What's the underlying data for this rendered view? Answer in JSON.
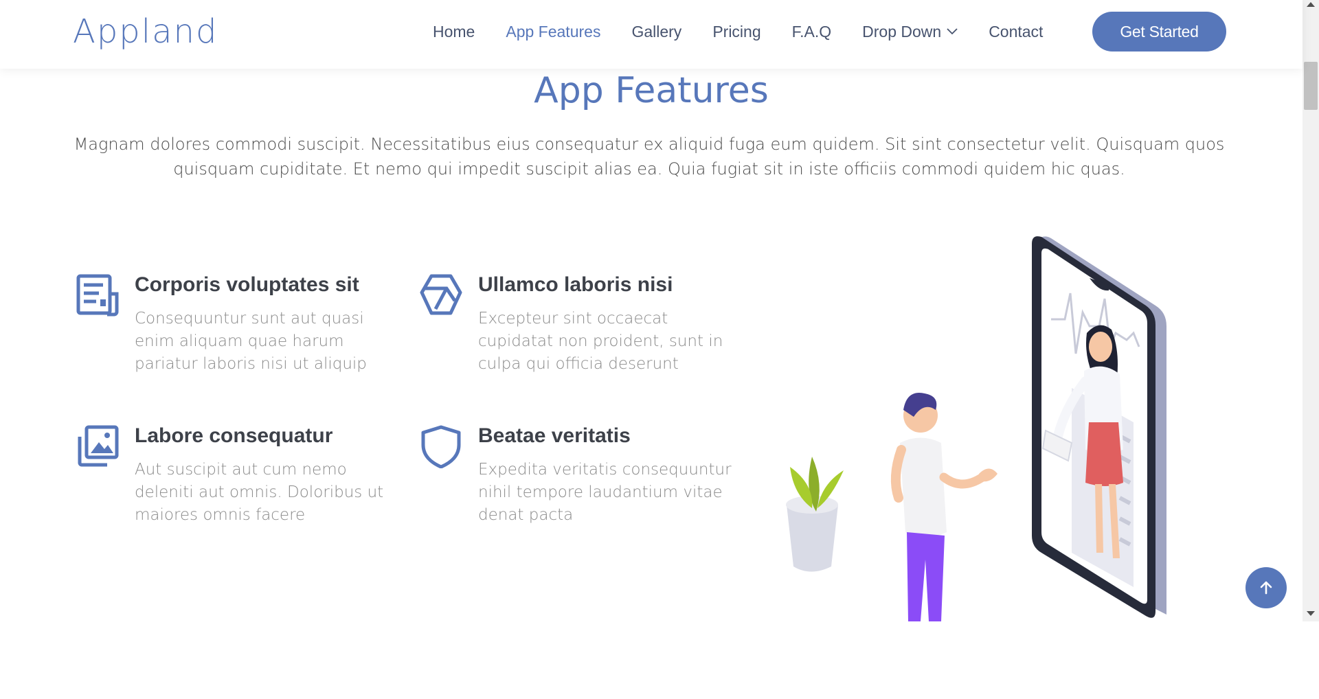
{
  "header": {
    "logo": "Appland",
    "nav": [
      {
        "label": "Home"
      },
      {
        "label": "App Features"
      },
      {
        "label": "Gallery"
      },
      {
        "label": "Pricing"
      },
      {
        "label": "F.A.Q"
      },
      {
        "label": "Drop Down"
      },
      {
        "label": "Contact"
      }
    ],
    "cta_label": "Get Started"
  },
  "section": {
    "title": "App Features",
    "description": "Magnam dolores commodi suscipit. Necessitatibus eius consequatur ex aliquid fuga eum quidem. Sit sint consectetur velit. Quisquam quos quisquam cupiditate. Et nemo qui impedit suscipit alias ea. Quia fugiat sit in iste officiis commodi quidem hic quas."
  },
  "features": [
    {
      "title": "Corporis voluptates sit",
      "text": "Consequuntur sunt aut quasi enim aliquam quae harum pariatur laboris nisi ut aliquip",
      "icon": "news-icon"
    },
    {
      "title": "Ullamco laboris nisi",
      "text": "Excepteur sint occaecat cupidatat non proident, sunt in culpa qui officia deserunt",
      "icon": "box-icon"
    },
    {
      "title": "Labore consequatur",
      "text": "Aut suscipit aut cum nemo deleniti aut omnis. Doloribus ut maiores omnis facere",
      "icon": "images-icon"
    },
    {
      "title": "Beatae veritatis",
      "text": "Expedita veritatis consequuntur nihil tempore laudantium vitae denat pacta",
      "icon": "shield-icon"
    }
  ],
  "colors": {
    "accent": "#5777ba",
    "heading": "#3d4149",
    "muted": "#8a8a8a"
  },
  "active_nav": "App Features"
}
